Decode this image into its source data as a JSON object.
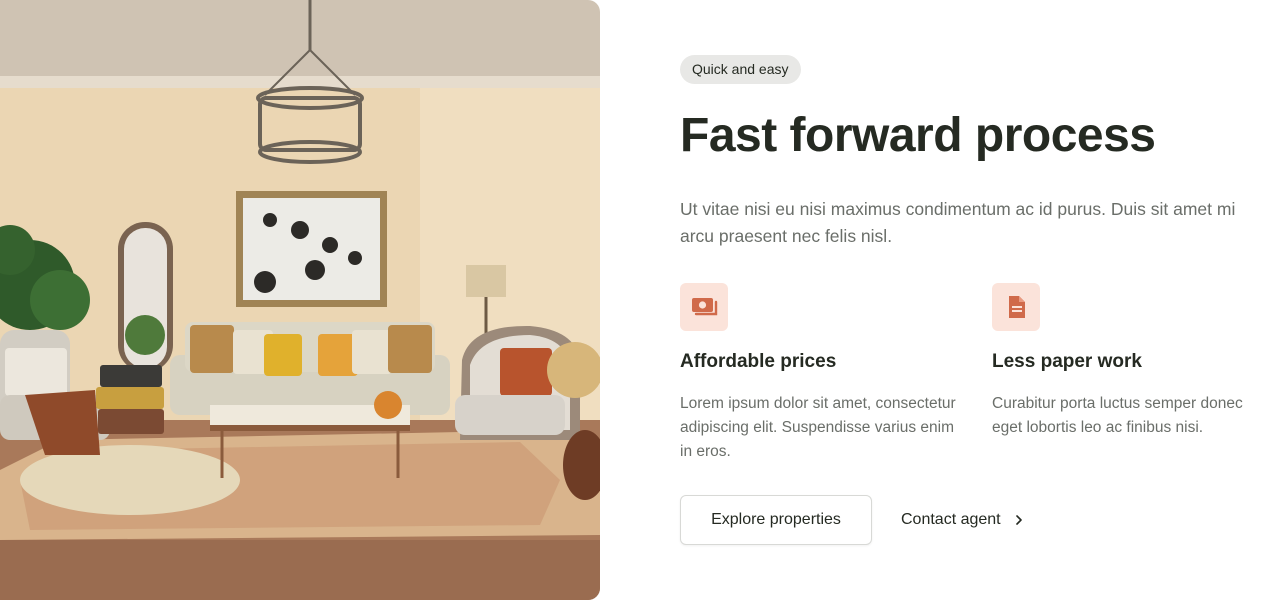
{
  "hero": {
    "image_alt": "Living room interior"
  },
  "badge": "Quick and easy",
  "title": "Fast forward process",
  "lead": "Ut vitae nisi eu nisi maximus condimentum ac id purus. Duis sit amet mi arcu praesent nec felis nisl.",
  "features": [
    {
      "icon": "money-icon",
      "title": "Affordable prices",
      "text": "Lorem ipsum dolor sit amet, consectetur adipiscing elit. Suspendisse varius enim in eros."
    },
    {
      "icon": "document-icon",
      "title": "Less paper work",
      "text": "Curabitur porta luctus semper donec eget lobortis leo ac finibus nisi."
    }
  ],
  "actions": {
    "primary_label": "Explore properties",
    "secondary_label": "Contact agent"
  },
  "colors": {
    "accent": "#d06a4a",
    "icon_bg": "#fbe3da",
    "heading": "#252a22",
    "body_text": "#6a6e69",
    "badge_bg": "#e8e8e6"
  }
}
